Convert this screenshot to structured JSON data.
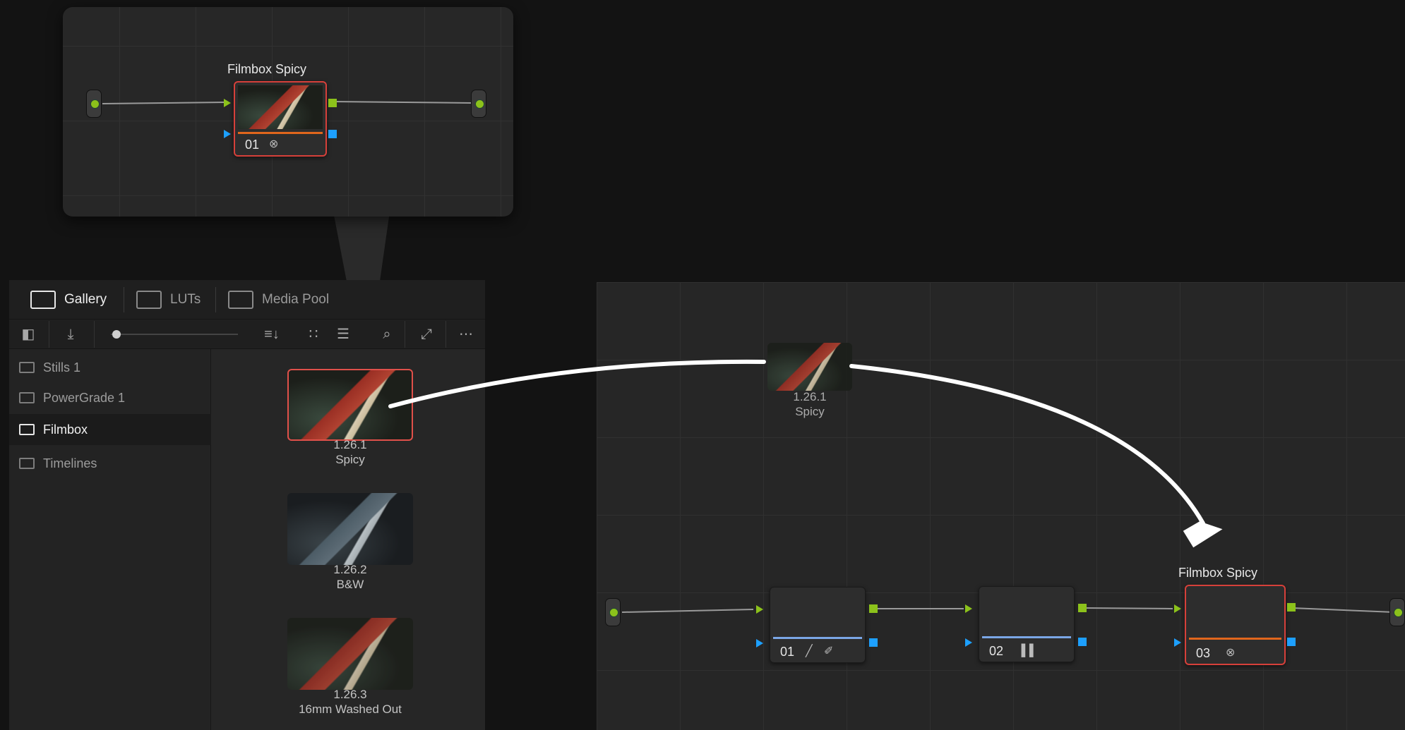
{
  "popup": {
    "node_label": "Filmbox Spicy",
    "node_number": "01"
  },
  "gallery": {
    "tabs": [
      {
        "label": "Gallery",
        "icon": "gallery-icon",
        "active": true
      },
      {
        "label": "LUTs",
        "icon": "luts-icon",
        "active": false
      },
      {
        "label": "Media Pool",
        "icon": "media-pool-icon",
        "active": false
      }
    ],
    "toolbar_icons": [
      "sidebar-toggle-icon",
      "import-icon",
      "zoom-slider",
      "sort-icon",
      "grid-view-icon",
      "list-view-icon",
      "search-icon",
      "fullscreen-icon",
      "more-options-icon"
    ],
    "albums": [
      {
        "label": "Stills 1",
        "active": false
      },
      {
        "label": "PowerGrade 1",
        "active": false
      },
      {
        "label": "Filmbox",
        "active": true
      },
      {
        "label": "Timelines",
        "active": false
      }
    ],
    "stills": [
      {
        "id": "1.26.1",
        "name": "Spicy",
        "selected": true
      },
      {
        "id": "1.26.2",
        "name": "B&W",
        "selected": false
      },
      {
        "id": "1.26.3",
        "name": "16mm Washed Out",
        "selected": false
      }
    ]
  },
  "graph": {
    "dragged_still": {
      "id": "1.26.1",
      "name": "Spicy"
    },
    "nodes": [
      {
        "number": "01",
        "label": "",
        "icons": "curves-icon qualifier-icon"
      },
      {
        "number": "02",
        "label": "",
        "icons": "bars-icon"
      },
      {
        "number": "03",
        "label": "Filmbox Spicy",
        "icons": "fx-icon",
        "selected": true
      }
    ]
  },
  "colors": {
    "accent_selected": "#d6403a",
    "port_green": "#8cc21b",
    "port_blue": "#1da0ff",
    "node_bar_orange": "#e0661c",
    "node_bar_blue": "#7aa6e6"
  }
}
